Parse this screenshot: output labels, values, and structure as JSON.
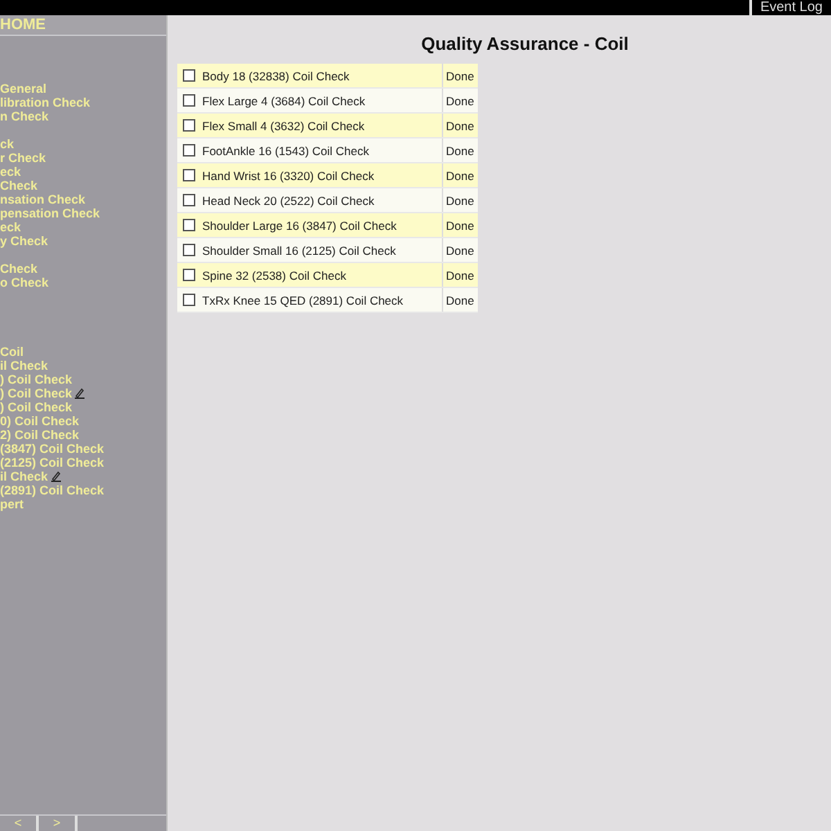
{
  "top_bar": {
    "event_log": "Event Log"
  },
  "sidebar": {
    "header": "HOME",
    "groups": [
      {
        "items": [
          {
            "label": "General",
            "marked": false
          },
          {
            "label": "libration Check",
            "marked": false
          },
          {
            "label": "n Check",
            "marked": false
          }
        ]
      },
      {
        "items": [
          {
            "label": "ck",
            "marked": false
          },
          {
            "label": "r Check",
            "marked": false
          },
          {
            "label": "eck",
            "marked": false
          },
          {
            "label": "Check",
            "marked": false
          },
          {
            "label": "nsation Check",
            "marked": false
          },
          {
            "label": "pensation Check",
            "marked": false
          },
          {
            "label": "eck",
            "marked": false
          },
          {
            "label": "y Check",
            "marked": false
          }
        ]
      },
      {
        "items": [
          {
            "label": "Check",
            "marked": false
          },
          {
            "label": "o Check",
            "marked": false
          }
        ]
      },
      {
        "items": [
          {
            "label": "Coil",
            "marked": false
          },
          {
            "label": "il Check",
            "marked": false
          },
          {
            "label": ") Coil Check",
            "marked": false
          },
          {
            "label": ") Coil Check",
            "marked": true
          },
          {
            "label": ") Coil Check",
            "marked": false
          },
          {
            "label": "0) Coil Check",
            "marked": false
          },
          {
            "label": "2) Coil Check",
            "marked": false
          },
          {
            "label": "(3847) Coil Check",
            "marked": false
          },
          {
            "label": "(2125) Coil Check",
            "marked": false
          },
          {
            "label": "il Check",
            "marked": true
          },
          {
            "label": "(2891) Coil Check",
            "marked": false
          },
          {
            "label": "pert",
            "marked": false
          }
        ]
      }
    ],
    "nav": [
      "<",
      ">"
    ]
  },
  "page": {
    "title": "Quality Assurance - Coil",
    "rows": [
      {
        "label": "Body 18 (32838) Coil Check",
        "checked": false,
        "status": "Done"
      },
      {
        "label": "Flex Large 4 (3684) Coil Check",
        "checked": false,
        "status": "Done"
      },
      {
        "label": "Flex Small 4 (3632) Coil Check",
        "checked": false,
        "status": "Done"
      },
      {
        "label": "FootAnkle 16 (1543) Coil Check",
        "checked": false,
        "status": "Done"
      },
      {
        "label": "Hand Wrist 16 (3320) Coil Check",
        "checked": false,
        "status": "Done"
      },
      {
        "label": "Head Neck 20 (2522) Coil Check",
        "checked": false,
        "status": "Done"
      },
      {
        "label": "Shoulder Large 16 (3847) Coil Check",
        "checked": false,
        "status": "Done"
      },
      {
        "label": "Shoulder Small 16 (2125) Coil Check",
        "checked": false,
        "status": "Done"
      },
      {
        "label": "Spine 32 (2538) Coil Check",
        "checked": false,
        "status": "Done"
      },
      {
        "label": "TxRx Knee 15 QED (2891) Coil Check",
        "checked": false,
        "status": "Done"
      }
    ]
  }
}
